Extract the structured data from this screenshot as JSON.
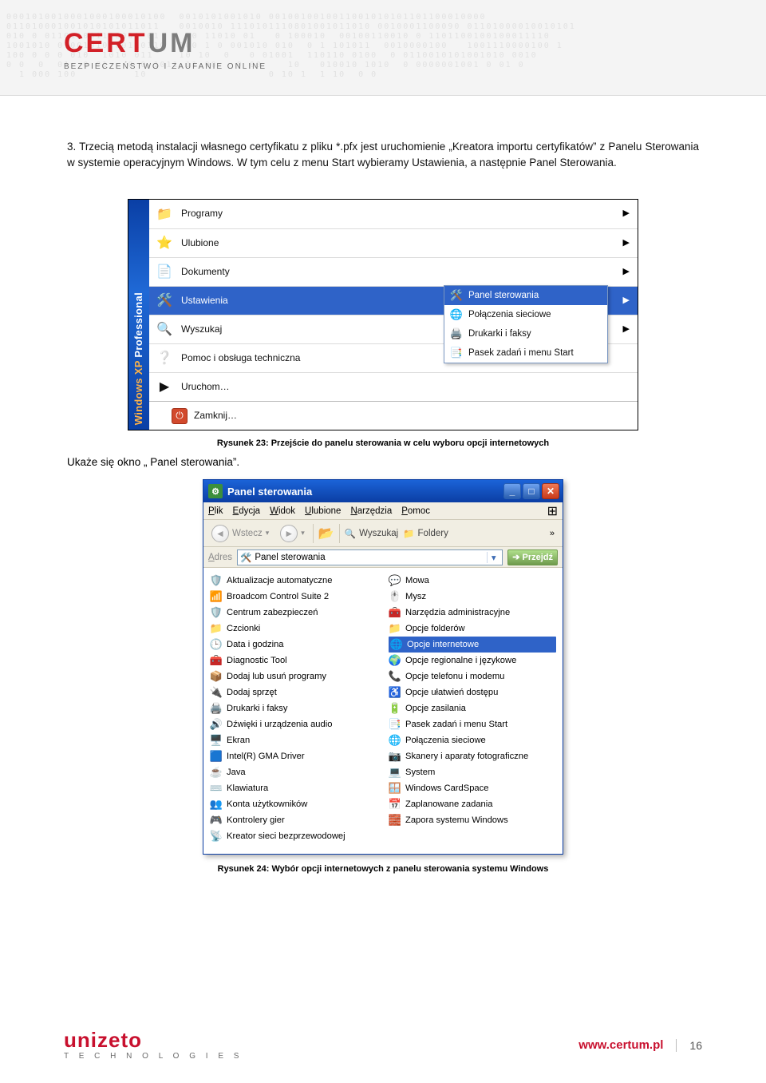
{
  "header": {
    "brand_pre": "CERT",
    "brand_suf": "UM",
    "tagline": "BEZPIECZEŃSTWO I ZAUFANIE ONLINE"
  },
  "paragraph": "3. Trzecią metodą instalacji własnego certyfikatu z pliku *.pfx jest uruchomienie „Kreatora importu certyfikatów” z Panelu Sterowania w systemie operacyjnym Windows. W tym celu z menu Start wybieramy Ustawienia, a następnie Panel Sterowania.",
  "startmenu": {
    "sidebar_os": "Windows XP ",
    "sidebar_ed": "Professional",
    "items": [
      {
        "icon": "📁",
        "label": "Programy",
        "arrow": true
      },
      {
        "icon": "⭐",
        "label": "Ulubione",
        "arrow": true
      },
      {
        "icon": "📄",
        "label": "Dokumenty",
        "arrow": true
      },
      {
        "icon": "🛠️",
        "label": "Ustawienia",
        "arrow": true,
        "hl": true
      },
      {
        "icon": "🔍",
        "label": "Wyszukaj",
        "arrow": true
      },
      {
        "icon": "❔",
        "label": "Pomoc i obsługa techniczna",
        "arrow": false
      },
      {
        "icon": "▶",
        "label": "Uruchom…",
        "arrow": false
      }
    ],
    "shutdown": "Zamknij…",
    "submenu": [
      {
        "icon": "🛠️",
        "label": "Panel sterowania",
        "hl": true
      },
      {
        "icon": "🌐",
        "label": "Połączenia sieciowe"
      },
      {
        "icon": "🖨️",
        "label": "Drukarki i faksy"
      },
      {
        "icon": "📑",
        "label": "Pasek zadań i menu Start"
      }
    ]
  },
  "caption23": "Rysunek 23: Przejście do panelu sterowania w celu wyboru opcji internetowych",
  "lead": "Ukaże się okno „ Panel sterowania”.",
  "cpanel": {
    "title": "Panel sterowania",
    "menu": [
      "Plik",
      "Edycja",
      "Widok",
      "Ulubione",
      "Narzędzia",
      "Pomoc"
    ],
    "back": "Wstecz",
    "search": "Wyszukaj",
    "folders": "Foldery",
    "address_label": "Adres",
    "address_value": "Panel sterowania",
    "go": "Przejdź",
    "col1": [
      {
        "ic": "🛡️",
        "t": "Aktualizacje automatyczne"
      },
      {
        "ic": "📶",
        "t": "Broadcom Control Suite 2"
      },
      {
        "ic": "🛡️",
        "t": "Centrum zabezpieczeń"
      },
      {
        "ic": "📁",
        "t": "Czcionki"
      },
      {
        "ic": "🕒",
        "t": "Data i godzina"
      },
      {
        "ic": "🧰",
        "t": "Diagnostic Tool"
      },
      {
        "ic": "📦",
        "t": "Dodaj lub usuń programy"
      },
      {
        "ic": "🔌",
        "t": "Dodaj sprzęt"
      },
      {
        "ic": "🖨️",
        "t": "Drukarki i faksy"
      },
      {
        "ic": "🔊",
        "t": "Dźwięki i urządzenia audio"
      },
      {
        "ic": "🖥️",
        "t": "Ekran"
      },
      {
        "ic": "🟦",
        "t": "Intel(R) GMA Driver"
      },
      {
        "ic": "☕",
        "t": "Java"
      },
      {
        "ic": "⌨️",
        "t": "Klawiatura"
      },
      {
        "ic": "👥",
        "t": "Konta użytkowników"
      },
      {
        "ic": "🎮",
        "t": "Kontrolery gier"
      },
      {
        "ic": "📡",
        "t": "Kreator sieci bezprzewodowej"
      }
    ],
    "col2": [
      {
        "ic": "💬",
        "t": "Mowa"
      },
      {
        "ic": "🖱️",
        "t": "Mysz"
      },
      {
        "ic": "🧰",
        "t": "Narzędzia administracyjne"
      },
      {
        "ic": "📁",
        "t": "Opcje folderów"
      },
      {
        "ic": "🌐",
        "t": "Opcje internetowe",
        "hl": true
      },
      {
        "ic": "🌍",
        "t": "Opcje regionalne i językowe"
      },
      {
        "ic": "📞",
        "t": "Opcje telefonu i modemu"
      },
      {
        "ic": "♿",
        "t": "Opcje ułatwień dostępu"
      },
      {
        "ic": "🔋",
        "t": "Opcje zasilania"
      },
      {
        "ic": "📑",
        "t": "Pasek zadań i menu Start"
      },
      {
        "ic": "🌐",
        "t": "Połączenia sieciowe"
      },
      {
        "ic": "📷",
        "t": "Skanery i aparaty fotograficzne"
      },
      {
        "ic": "💻",
        "t": "System"
      },
      {
        "ic": "🪟",
        "t": "Windows CardSpace"
      },
      {
        "ic": "📅",
        "t": "Zaplanowane zadania"
      },
      {
        "ic": "🧱",
        "t": "Zapora systemu Windows"
      }
    ]
  },
  "caption24": "Rysunek 24: Wybór opcji internetowych z panelu sterowania systemu Windows",
  "footer": {
    "brand": "unizeto",
    "sub": "T E C H N O L O G I E S",
    "link": "www.certum.pl",
    "page": "16"
  }
}
